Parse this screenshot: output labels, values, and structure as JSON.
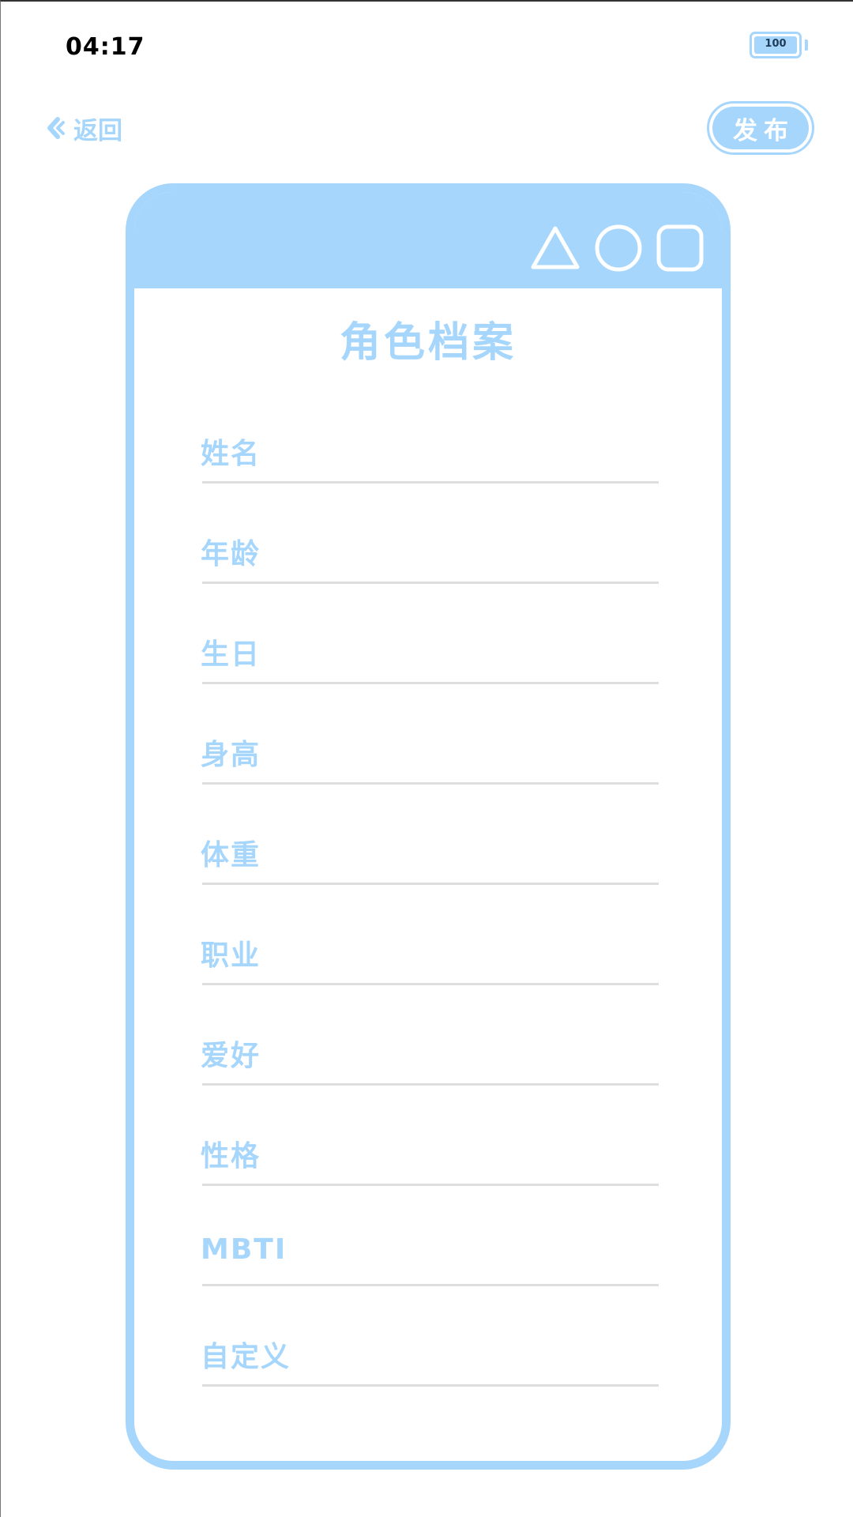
{
  "status_bar": {
    "time": "04:17",
    "battery": "100",
    "battery_level": 1.0
  },
  "nav": {
    "back_label": "返回",
    "publish_label": "发布"
  },
  "card": {
    "title": "角色档案",
    "window_icons": [
      "triangle-icon",
      "circle-icon",
      "square-icon"
    ],
    "fields": [
      {
        "label": "姓名",
        "value": ""
      },
      {
        "label": "年龄",
        "value": ""
      },
      {
        "label": "生日",
        "value": ""
      },
      {
        "label": "身高",
        "value": ""
      },
      {
        "label": "体重",
        "value": ""
      },
      {
        "label": "职业",
        "value": ""
      },
      {
        "label": "爱好",
        "value": ""
      },
      {
        "label": "性格",
        "value": ""
      },
      {
        "label": "MBTI",
        "value": ""
      },
      {
        "label": "自定义",
        "value": ""
      }
    ]
  },
  "colors": {
    "accent": "#a6d6fb",
    "divider": "#dedede",
    "background": "#ffffff",
    "status_text": "#000000"
  }
}
